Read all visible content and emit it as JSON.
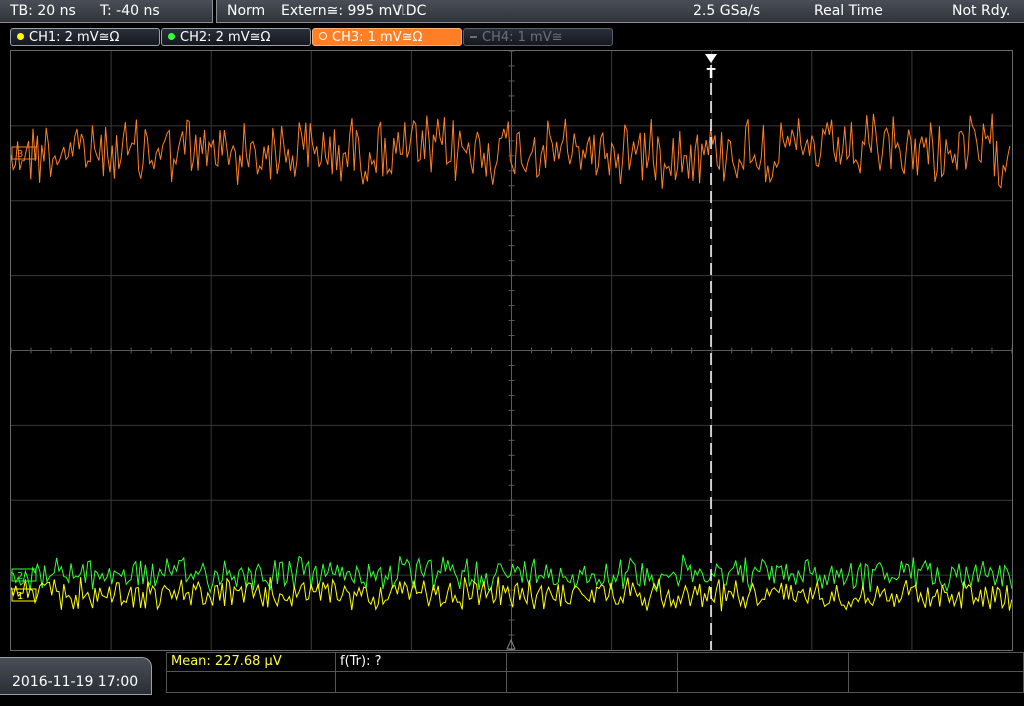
{
  "top": {
    "timebase": "TB: 20 ns",
    "trigger_time": "T: -40 ns",
    "mode": "Norm",
    "trigger_source": "Extern≅: 995 mV",
    "trigger_slope": "⎍DC",
    "sample_rate": "2.5 GSa/s",
    "acq_mode": "Real Time",
    "status": "Not Rdy."
  },
  "channels": [
    {
      "label": "CH1: 2 mV≅Ω",
      "color": "#ffff00",
      "state": "on"
    },
    {
      "label": "CH2: 2 mV≅Ω",
      "color": "#33ff33",
      "state": "on"
    },
    {
      "label": "CH3: 1 mV≅Ω",
      "color": "#ff7f27",
      "state": "active"
    },
    {
      "label": "CH4: 1 mV≅",
      "color": "#6b6f76",
      "state": "off"
    }
  ],
  "markers": {
    "trigger_marker": "T",
    "ch1": "1",
    "ch2": "2",
    "ch3": "3"
  },
  "bottom": {
    "datetime": "2016-11-19 17:00",
    "mean_label": "Mean: 227.68 µV",
    "freq_label": "f(Tr): ?"
  },
  "colors": {
    "ch1": "#ffff00",
    "ch2": "#33ff33",
    "ch3": "#ff7f27",
    "grid": "#3a3a3a",
    "trigger_line": "#ffffff"
  }
}
